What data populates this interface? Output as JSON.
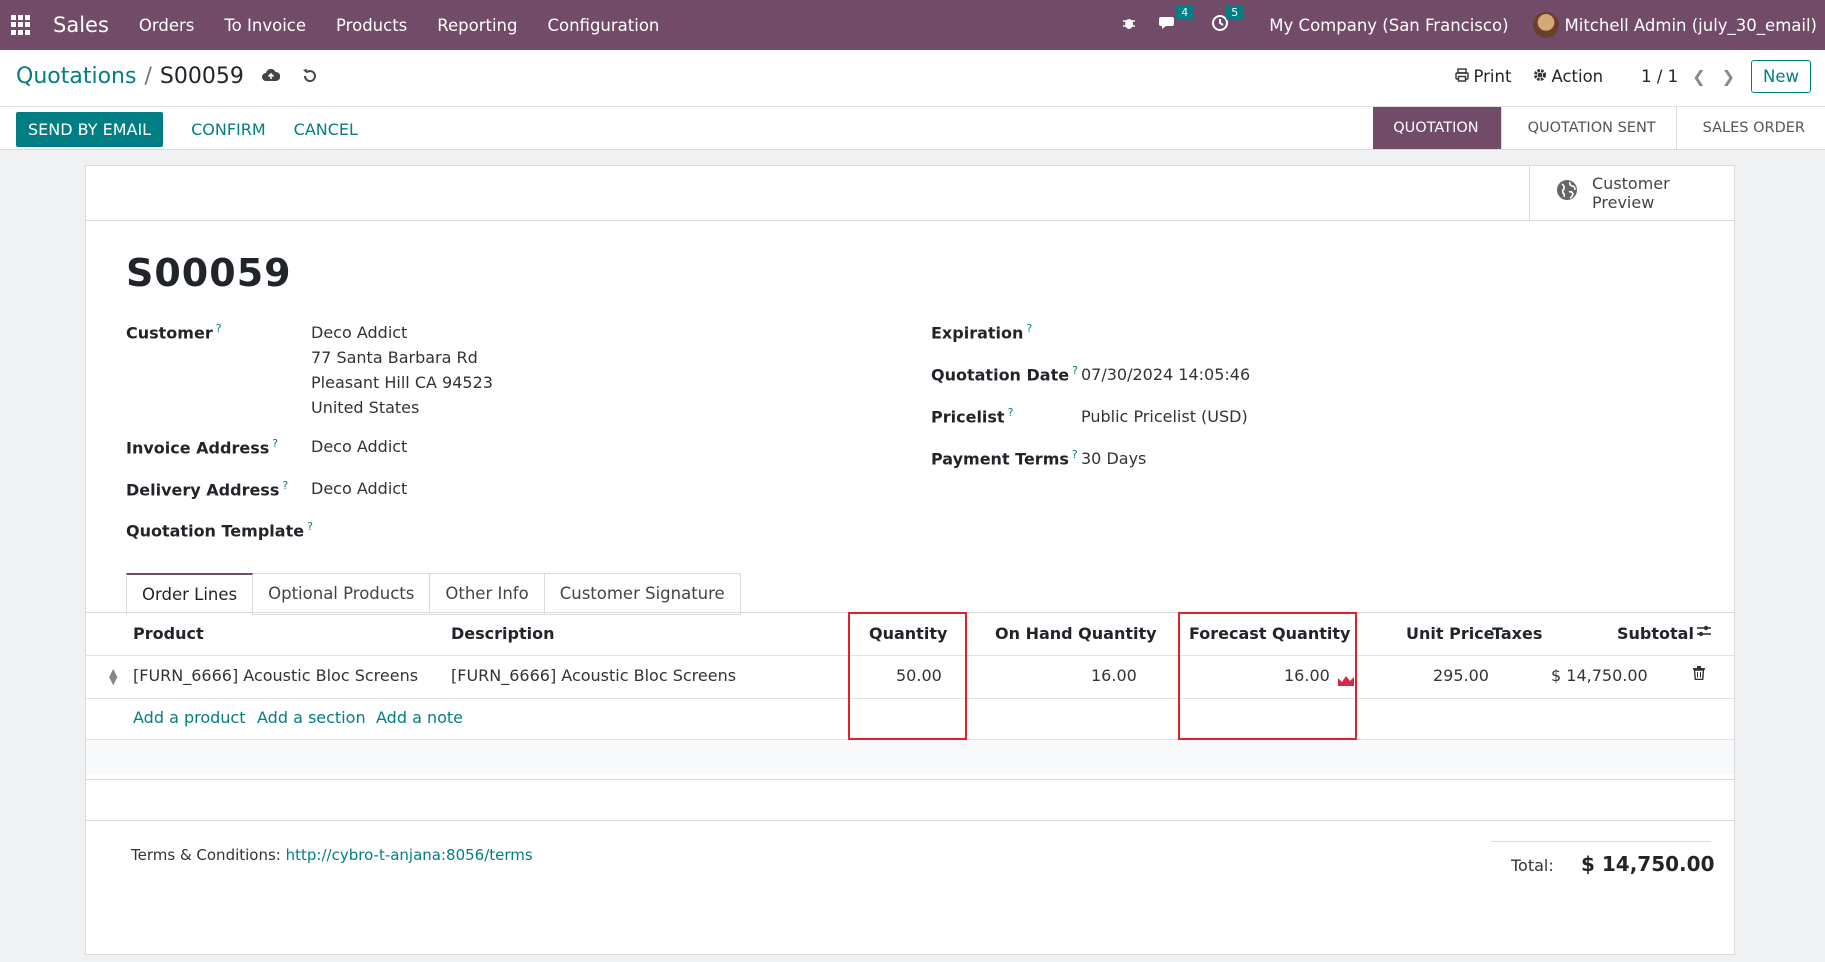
{
  "navbar": {
    "app": "Sales",
    "menu": [
      "Orders",
      "To Invoice",
      "Products",
      "Reporting",
      "Configuration"
    ],
    "messages_badge": "4",
    "activities_badge": "5",
    "company": "My Company (San Francisco)",
    "user": "Mitchell Admin (july_30_email)"
  },
  "control": {
    "breadcrumb_parent": "Quotations",
    "breadcrumb_current": "S00059",
    "print": "Print",
    "action": "Action",
    "pager": "1 / 1",
    "new": "New"
  },
  "actions": {
    "send_email": "SEND BY EMAIL",
    "confirm": "CONFIRM",
    "cancel": "CANCEL"
  },
  "status": {
    "stages": [
      "QUOTATION",
      "QUOTATION SENT",
      "SALES ORDER"
    ],
    "active": "QUOTATION"
  },
  "sheet": {
    "customer_preview": "Customer Preview",
    "title": "S00059",
    "customer_label": "Customer",
    "customer_lines": [
      "Deco Addict",
      "77 Santa Barbara Rd",
      "Pleasant Hill CA 94523",
      "United States"
    ],
    "invoice_label": "Invoice Address",
    "invoice_value": "Deco Addict",
    "delivery_label": "Delivery Address",
    "delivery_value": "Deco Addict",
    "template_label": "Quotation Template",
    "expiration_label": "Expiration",
    "qdate_label": "Quotation Date",
    "qdate_value": "07/30/2024 14:05:46",
    "pricelist_label": "Pricelist",
    "pricelist_value": "Public Pricelist (USD)",
    "terms_label": "Payment Terms",
    "terms_value": "30 Days"
  },
  "tabs": [
    "Order Lines",
    "Optional Products",
    "Other Info",
    "Customer Signature"
  ],
  "table": {
    "headers": {
      "product": "Product",
      "description": "Description",
      "quantity": "Quantity",
      "on_hand": "On Hand Quantity",
      "forecast": "Forecast Quantity",
      "unit_price": "Unit Price",
      "taxes": "Taxes",
      "subtotal": "Subtotal"
    },
    "row": {
      "product": "[FURN_6666] Acoustic Bloc Screens",
      "description": "[FURN_6666] Acoustic Bloc Screens",
      "quantity": "50.00",
      "on_hand": "16.00",
      "forecast": "16.00",
      "unit_price": "295.00",
      "subtotal": "$ 14,750.00"
    },
    "add_product": "Add a product",
    "add_section": "Add a section",
    "add_note": "Add a note"
  },
  "footer": {
    "terms_label": "Terms & Conditions:",
    "terms_link": "http://cybro-t-anjana:8056/terms",
    "total_label": "Total:",
    "total_value": "$ 14,750.00"
  },
  "colors": {
    "brand": "#714b67",
    "accent": "#017e84",
    "highlight_box": "#e0202a"
  }
}
